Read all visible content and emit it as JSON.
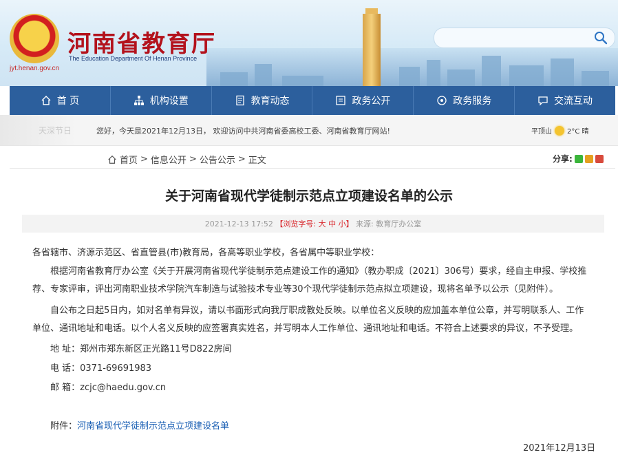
{
  "header": {
    "site_title": "河南省教育厅",
    "site_subtitle": "The Education Department Of Henan Province",
    "domain": "jyt.henan.gov.cn"
  },
  "search": {
    "placeholder": ""
  },
  "nav": [
    {
      "label": "首 页",
      "icon": "home-icon"
    },
    {
      "label": "机构设置",
      "icon": "org-chart-icon"
    },
    {
      "label": "教育动态",
      "icon": "document-icon"
    },
    {
      "label": "政务公开",
      "icon": "notice-icon"
    },
    {
      "label": "政务服务",
      "icon": "service-icon"
    },
    {
      "label": "交流互动",
      "icon": "chat-icon"
    }
  ],
  "welcome": {
    "tag": "天深节日",
    "message": "您好，今天是2021年12月13日， 欢迎访问中共河南省委高校工委、河南省教育厅网站!",
    "city": "平顶山",
    "temp": "2°C 晴"
  },
  "breadcrumb": {
    "home": "首页",
    "sep1": ">",
    "b1": "信息公开",
    "sep2": ">",
    "b2": "公告公示",
    "sep3": ">",
    "b3": "正文"
  },
  "share": {
    "label": "分享:"
  },
  "article": {
    "title": "关于河南省现代学徒制示范点立项建设名单的公示",
    "meta_date": "2021-12-13 17:52",
    "meta_font_open": "【浏览字号:",
    "meta_font_big": "大",
    "meta_font_mid": "中",
    "meta_font_small": "小",
    "meta_font_close": "】",
    "meta_source": "来源: 教育厅办公室",
    "salutation": "各省辖市、济源示范区、省直管县(市)教育局，各高等职业学校，各省属中等职业学校：",
    "p1": "根据河南省教育厅办公室《关于开展河南省现代学徒制示范点建设工作的通知》（教办职成〔2021〕306号）要求，经自主申报、学校推荐、专家评审，评出河南职业技术学院汽车制造与试验技术专业等30个现代学徒制示范点拟立项建设，现将名单予以公示（见附件）。",
    "p2": "自公布之日起5日内，如对名单有异议，请以书面形式向我厅职成教处反映。以单位名义反映的应加盖本单位公章，并写明联系人、工作单位、通讯地址和电话。以个人名义反映的应签署真实姓名，并写明本人工作单位、通讯地址和电话。不符合上述要求的异议，不予受理。",
    "address": "地 址：郑州市郑东新区正光路11号D822房间",
    "phone": "电 话：0371-69691983",
    "email": "邮 箱：zcjc@haedu.gov.cn",
    "attach_label": "附件：",
    "attach_link": "河南省现代学徒制示范点立项建设名单",
    "sign_date": "2021年12月13日"
  },
  "colors": {
    "nav": "#2c5f9d",
    "title_red": "#b3121c",
    "link": "#1a5fb4"
  }
}
